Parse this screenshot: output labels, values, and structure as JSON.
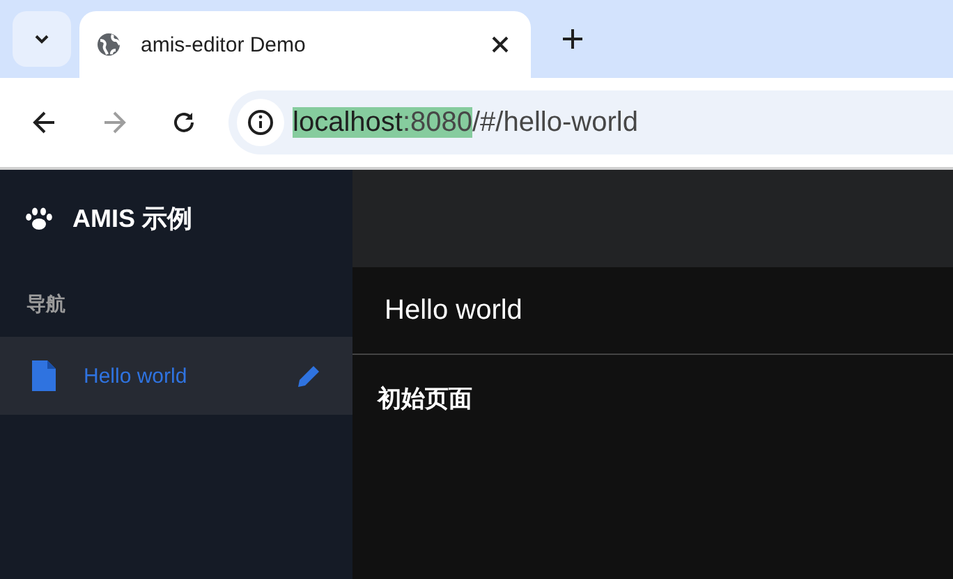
{
  "browser": {
    "tabs": [
      {
        "title": "amis-editor Demo",
        "selected": true
      }
    ],
    "nav_buttons": [
      {
        "kind": "back",
        "disabled": false
      },
      {
        "kind": "forward",
        "disabled": true
      },
      {
        "kind": "reload",
        "disabled": false
      }
    ],
    "url": [
      {
        "text": "localhost",
        "emphasized": true,
        "selected": true
      },
      {
        "text": ":8080",
        "emphasized": false,
        "selected": true
      },
      {
        "text": "/#/hello-world",
        "emphasized": false,
        "selected": false
      }
    ]
  },
  "sidebar": {
    "brand": "AMIS 示例",
    "group": "导航",
    "items": [
      {
        "label": "Hello world",
        "selected": true
      }
    ]
  },
  "page": {
    "title": "Hello world",
    "body": "初始页面"
  }
}
